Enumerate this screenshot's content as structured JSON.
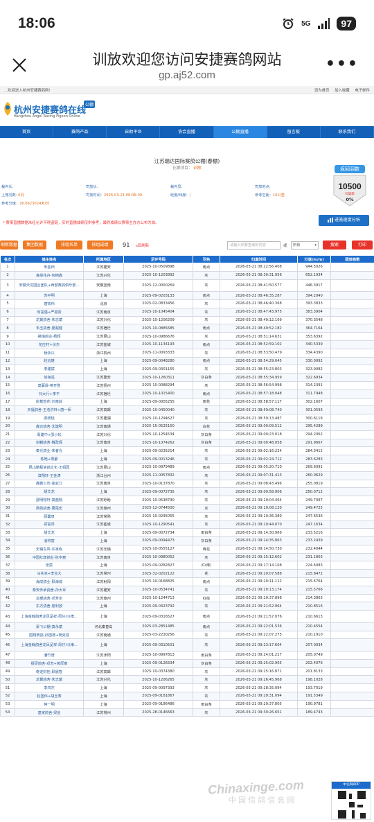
{
  "status_bar": {
    "time": "18:06",
    "network": "5G",
    "battery": "97"
  },
  "browser": {
    "title": "训放欢迎您访问安捷赛鸽网站",
    "url": "gp.aj52.com"
  },
  "site": {
    "welcome": "...欢迎进入杭州安捷赛鸽网!",
    "top_links": [
      "设为首页",
      "加入收藏",
      "电子邮件"
    ],
    "logo_text": "杭州安捷赛鸽在线",
    "logo_sub": "Hangzhou Angel Racing Pigeon Online",
    "logo_badge": "公棚",
    "nav": [
      "首页",
      "赛鸽产品",
      "自助平台",
      "协会直播",
      "公棚直播",
      "留言板",
      "联系我们"
    ],
    "race_title": "江苏瑞达国际赛鸽公棚(春棚)",
    "race_sub_label": "比赛项目：",
    "race_sub_value": "训放",
    "info": {
      "r1": [
        "裁判长:",
        "司放长:",
        "裁判员:",
        "司放地点:"
      ],
      "r2_label1": "上笼羽数:",
      "r2_val1": "0羽",
      "r2_label2": "司放时间：",
      "r2_val2": "2026-03-21 08:06:00",
      "r2_label3": "经度/纬度：",
      "r2_val3": "/",
      "r2_label4": "参考空距：",
      "r2_val4": "16公里",
      "r3_label": "参考分速：",
      "r3_val": "26.6623024米/分"
    },
    "return_btn": "返回羽数",
    "return_count": "10500",
    "return_label": "归巢率",
    "return_pct": "0%",
    "notice": "* 赛事直播数据未经允许不得盗链，实时直播成绩仅供参考，最终成绩以赛事主办方公布为准。",
    "speed_btn": "进笼速度分析",
    "toolbar": {
      "b1": "刷新数据",
      "b2": "集团数据",
      "b3": "排组名单",
      "b4": "排组成绩",
      "count": "91",
      "refresh": "s后刷新",
      "search_placeholder": "请输入你要查询的内容",
      "or": "或",
      "select": "所有",
      "search": "搜索",
      "print": "打印"
    }
  },
  "table": {
    "headers": [
      "名次",
      "鸽主姓名",
      "所属地区",
      "足环号码",
      "羽色",
      "归巢时间",
      "分速(m/m)",
      "团体核数"
    ],
    "rows": [
      [
        "1",
        "朱金田",
        "江苏建安",
        "2025-10-0509898",
        "雨点",
        "2026-03-21 08:22:56.408",
        "944.5026",
        ""
      ],
      [
        "2",
        "真缘花卉-包楠鑫",
        "江苏兴化",
        "2025-10-1203892",
        "灰",
        "2026-03-21 08:30:31.956",
        "652.1934",
        ""
      ],
      [
        "3",
        "安徽天龙园合团队+西部赛鸽俱乐部...",
        "安徽宣南",
        "2025-12-0000269",
        "灰",
        "2026-03-21 08:41:50.577",
        "446.3917",
        ""
      ],
      [
        "4",
        "苏中明",
        "上海",
        "2025-09-0203133",
        "雨点",
        "2026-03-21 08:46:35.287",
        "394.2040",
        ""
      ],
      [
        "5",
        "唐铁伟",
        "北京",
        "2025-02-0833456",
        "灰",
        "2026-03-21 08:46:40.368",
        "393.3833",
        ""
      ],
      [
        "6",
        "何富强+严振贵",
        "江苏南京",
        "2025-10-1045404",
        "灰",
        "2026-03-21 08:47:43.975",
        "383.3904",
        ""
      ],
      [
        "7",
        "龙翼鸽舍-朱志斌",
        "江苏兴化",
        "2025-10-1206209",
        "灰",
        "2026-03-21 08:49:12.109",
        "370.3548",
        ""
      ],
      [
        "8",
        "韦玉鸽舍-夏超健",
        "江苏宿迁",
        "2025-10-0885685",
        "雨点",
        "2026-03-21 08:49:52.182",
        "364.7164",
        ""
      ],
      [
        "9",
        "禅瑞鸽业-杨辉",
        "江苏昆山",
        "2025-10-0986676",
        "灰",
        "2026-03-21 08:51:14.631",
        "353.6392",
        ""
      ],
      [
        "10",
        "花庄村+伏杰",
        "江苏盐城",
        "2025-10-1134193",
        "雨点",
        "2026-03-21 08:52:59.102",
        "340.5339",
        ""
      ],
      [
        "11",
        "杨永兴",
        "浙江杭州",
        "2025-11-0093333",
        "灰",
        "2026-03-21 08:53:50.479",
        "334.4390",
        ""
      ],
      [
        "12",
        "赵远雄",
        "上海",
        "2025-09-0048280",
        "雨点",
        "2026-03-21 08:54:29.045",
        "330.0092",
        ""
      ],
      [
        "13",
        "李建斌",
        "上海",
        "2025-09-0301155",
        "灰",
        "2026-03-21 08:55:23.803",
        "323.9082",
        ""
      ],
      [
        "14",
        "徐海溪",
        "江苏建安",
        "2025-10-1260311",
        "灰白条",
        "2026-03-21 08:55:34.959",
        "322.6934",
        ""
      ],
      [
        "15",
        "莫暮晨-蒋开胜",
        "江苏扬州",
        "2025-10-0088294",
        "灰",
        "2026-03-21 08:56:54.998",
        "314.2391",
        ""
      ],
      [
        "16",
        "刘大行+李平",
        "江苏宿迁",
        "2025-10-1015400",
        "雨点",
        "2026-03-21 08:57:18.048",
        "311.7948",
        ""
      ],
      [
        "17",
        "彩载管花-刘富龄",
        "上海",
        "2025-09-0005255",
        "雨花",
        "2026-03-21 08:58:57.117",
        "302.1607",
        ""
      ],
      [
        "18",
        "天福鸽舍-王浩洪林+唐一师",
        "江苏高邮",
        "2025-10-0450040",
        "灰",
        "2026-03-21 08:59:08.740",
        "301.0593",
        ""
      ],
      [
        "19",
        "梁缤桂",
        "江苏建湖",
        "2025-10-1294627",
        "灰",
        "2026-03-21 08:59:13.487",
        "300.6118",
        ""
      ],
      [
        "20",
        "鑫达鸽舍-沈建明",
        "江苏南通",
        "2025-15-0525150",
        "白花",
        "2026-03-21 09:00:09.512",
        "295.4289",
        ""
      ],
      [
        "21",
        "周建中+邵小松",
        "江苏兴化",
        "2025-10-1254534",
        "灰白条",
        "2026-03-21 09:00:23.018",
        "294.2062",
        ""
      ],
      [
        "22",
        "剑麟鸽舍-魏政辉",
        "江苏南京",
        "2025-10-1074262",
        "灰白条",
        "2026-03-21 09:00:48.058",
        "291.9667",
        ""
      ],
      [
        "23",
        "泰光鸽业-朱者光",
        "上海",
        "2025-09-0235214",
        "灰",
        "2026-03-21 09:02:16.224",
        "284.3412",
        ""
      ],
      [
        "24",
        "陈皓+周都",
        "上海",
        "2025-09-0013246",
        "灰",
        "2026-03-21 09:02:24.712",
        "283.6283",
        ""
      ],
      [
        "25",
        "昆山鹏程信鸽文化-王姐园",
        "江苏昆山",
        "2025-10-0979489",
        "雨点",
        "2026-03-21 09:05:20.710",
        "269.6091",
        ""
      ],
      [
        "26",
        "滨翔轩-王金涛",
        "浙江台州",
        "2025-11-0057832",
        "灰",
        "2026-03-21 09:07:31.413",
        "260.0629",
        ""
      ],
      [
        "27",
        "鑫鹏公司-金亚江",
        "江苏南京",
        "2025-10-0137870",
        "灰",
        "2026-03-21 09:08:43.496",
        "255.0819",
        ""
      ],
      [
        "28",
        "胡艾龙",
        "上海",
        "2025-09-0072735",
        "灰",
        "2026-03-21 09:09:58.906",
        "250.0712",
        ""
      ],
      [
        "29",
        "邵明翔轩-葵茜翔",
        "江苏盱眙",
        "2025-10-0538790",
        "灰",
        "2026-03-21 09:10:04.464",
        "249.7097",
        ""
      ],
      [
        "30",
        "扬帆鸽舍-曹尾宏",
        "江苏泰州",
        "2025-12-0744500",
        "灰",
        "2026-03-21 09:10:08.120",
        "249.4725",
        ""
      ],
      [
        "31",
        "顾馨泉",
        "江苏常熟",
        "2025-10-0295055",
        "灰",
        "2026-03-21 09:10:36.380",
        "247.6536",
        ""
      ],
      [
        "32",
        "郑富泽",
        "江苏盐城",
        "2025-10-1290541",
        "灰",
        "2026-03-21 09:10:44.070",
        "247.1634",
        ""
      ],
      [
        "33",
        "胡艾龙",
        "上海",
        "2025-09-0072734",
        "雨白条",
        "2026-03-21 09:14:30.969",
        "233.5216",
        ""
      ],
      [
        "34",
        "凌林富",
        "上海",
        "2025-09-0094473",
        "灰白条",
        "2026-03-21 09:14:35.863",
        "233.2439",
        ""
      ],
      [
        "35",
        "无锡东风-许家栋",
        "江苏无锡",
        "2025-10-0555127",
        "绛花",
        "2026-03-21 09:14:50.730",
        "232.4044",
        ""
      ],
      [
        "36",
        "中国红旗鸽业-阮宇宸",
        "江苏南京",
        "2025-10-0980052",
        "灰",
        "2026-03-21 09:15:12.602",
        "231.1803",
        ""
      ],
      [
        "37",
        "张宸",
        "上海",
        "2025-09-0282827",
        "红(绛)",
        "2026-03-21 09:17:14.108",
        "224.6083",
        ""
      ],
      [
        "38",
        "马先克+李宝大",
        "江苏常州",
        "2025-32-0202122",
        "花",
        "2026-03-21 09:20:07.588",
        "215.8472",
        ""
      ],
      [
        "39",
        "海成鸽业-顾海成",
        "江苏射阳",
        "2025-10-0168825",
        "雨点",
        "2026-03-21 09:20:11.112",
        "215.6764",
        ""
      ],
      [
        "40",
        "泰安传承鸽舍-孙大军",
        "江苏建安",
        "2025-10-0534741",
        "灰",
        "2026-03-21 09:20:13.174",
        "215.5766",
        ""
      ],
      [
        "41",
        "龙耀鸽舍-邓芳定",
        "江苏泰州",
        "2025-10-1244713",
        "红绘",
        "2026-03-21 09:20:37.898",
        "214.3863",
        ""
      ],
      [
        "42",
        "东方鸽舍-庞利放",
        "上海",
        "2025-09-0323792",
        "灰",
        "2026-03-21 09:21:52.964",
        "210.8516",
        ""
      ],
      [
        "43",
        "上海金翰鸽舍龙凤呈祥-周仔川(棣...",
        "上海",
        "2025-09-0316527",
        "雨点",
        "2026-03-21 09:21:57.076",
        "210.6613",
        ""
      ],
      [
        "44",
        "豪飞公棚-莫永斌",
        "河北秦皇岛",
        "2025-03-2851485",
        "雨点",
        "2026-03-21 09:22:01.536",
        "210.4554",
        ""
      ],
      [
        "45",
        "国翔赛鸽-孙国德+杨克成",
        "江苏南通",
        "2025-03-2230256",
        "灰",
        "2026-03-21 09:22:07.275",
        "210.1910",
        ""
      ],
      [
        "46",
        "上海金翰鸽舍龙凤呈祥-周仔川(棣...",
        "上海",
        "2025-09-0310501",
        "灰",
        "2026-03-21 09:23:17.604",
        "207.0034",
        ""
      ],
      [
        "47",
        "潘竹谱",
        "江苏沭阳",
        "2025-10-0997813",
        "雨白条",
        "2026-03-21 09:24:01.217",
        "205.0749",
        ""
      ],
      [
        "48",
        "振研鸽舍-邓苏+黄厚章",
        "上海",
        "2025-09-0128334",
        "灰白条",
        "2026-03-21 09:25:02.905",
        "202.4076",
        ""
      ],
      [
        "49",
        "奇迹财拓-顾晨智",
        "江苏高邮",
        "2025-10-0374380",
        "灰",
        "2026-03-21 09:25:16.871",
        "201.8133",
        ""
      ],
      [
        "50",
        "龙翼鸽舍-朱志斌",
        "江苏兴化",
        "2025-10-1206265",
        "灰",
        "2026-03-21 09:26:45.968",
        "198.1028",
        ""
      ],
      [
        "51",
        "李鸿杰",
        "上海",
        "2025-09-0097393",
        "灰",
        "2026-03-21 09:28:35.094",
        "193.7019",
        ""
      ],
      [
        "52",
        "赵国伟+胡玉寿",
        "上海",
        "2025-09-0181867",
        "灰",
        "2026-03-21 09:29:31.094",
        "191.5349",
        ""
      ],
      [
        "53",
        "蒋一明",
        "上海",
        "2025-09-0186486",
        "雨白条",
        "2026-03-21 09:29:37.805",
        "190.9781",
        ""
      ],
      [
        "54",
        "皇家鸽舍-梁创",
        "江苏常州",
        "2025-28-0146663",
        "灰",
        "2026-03-21 09:30:26.651",
        "189.4743",
        ""
      ]
    ]
  },
  "watermark": {
    "main": "Chinaxinge.com",
    "sub": "中 国 信 鸽 信 息 网",
    "qr_label": "中信网APP"
  }
}
